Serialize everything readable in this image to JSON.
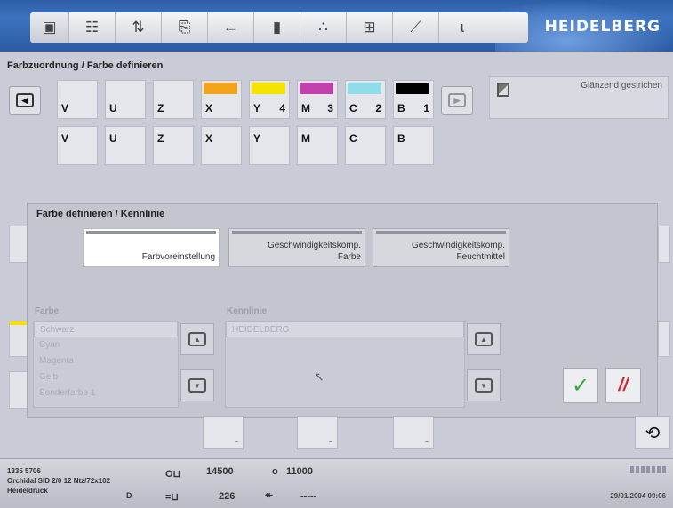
{
  "toolbar": {
    "brand": "HEIDELBERG",
    "tools": [
      {
        "name": "device-tool",
        "glyph": "▣"
      },
      {
        "name": "list-tool",
        "glyph": "☷"
      },
      {
        "name": "transfer-tool",
        "glyph": "⇅"
      },
      {
        "name": "paper-tool",
        "glyph": "⎘"
      },
      {
        "name": "arrow-tool",
        "glyph": "←"
      },
      {
        "name": "ink-tool",
        "glyph": "▮"
      },
      {
        "name": "spray-tool",
        "glyph": "∴"
      },
      {
        "name": "plate-tool",
        "glyph": "⊞"
      },
      {
        "name": "measure-tool",
        "glyph": "⟋"
      },
      {
        "name": "signal-tool",
        "glyph": "ɩ"
      }
    ]
  },
  "section_title": "Farbzuordnung / Farbe definieren",
  "nav": {
    "prev_glyph": "◀",
    "next_glyph": "▶"
  },
  "top_units": [
    {
      "label": "V",
      "num": "",
      "color": ""
    },
    {
      "label": "U",
      "num": "",
      "color": ""
    },
    {
      "label": "Z",
      "num": "",
      "color": ""
    },
    {
      "label": "X",
      "num": "",
      "color": "#f2a51c"
    },
    {
      "label": "Y",
      "num": "4",
      "color": "#f6e400"
    },
    {
      "label": "M",
      "num": "3",
      "color": "#c23fae"
    },
    {
      "label": "C",
      "num": "2",
      "color": "#8fdde9"
    },
    {
      "label": "B",
      "num": "1",
      "color": "#000000"
    }
  ],
  "bottom_units": [
    "V",
    "U",
    "Z",
    "X",
    "Y",
    "M",
    "C",
    "B"
  ],
  "paper_info": "Glänzend gestrichen",
  "dialog": {
    "title": "Farbe definieren / Kennlinie",
    "modes": [
      {
        "line1": "",
        "line2": "Farbvoreinstellung",
        "active": true
      },
      {
        "line1": "Geschwindigkeitskomp.",
        "line2": "Farbe",
        "active": false
      },
      {
        "line1": "Geschwindigkeitskomp.",
        "line2": "Feuchtmittel",
        "active": false
      }
    ],
    "farbe_label": "Farbe",
    "farbe_items": [
      "Schwarz",
      "Cyan",
      "Magenta",
      "Gelb",
      "Sonderfarbe 1"
    ],
    "kennlinie_label": "Kennlinie",
    "kennlinie_items": [
      "HEIDELBERG"
    ],
    "ok_glyph": "✓",
    "cancel_glyph": "//"
  },
  "bottom_buttons": [
    "-",
    "-",
    "-"
  ],
  "status": {
    "job_line1": "1335 5706",
    "job_line2": "Orchidal SID 2/0 12 Ntz/72x102",
    "job_line3": "Heideldruck",
    "job_mark": "D",
    "counter1_symbol": "O⊔",
    "counter1": "14500",
    "counter2_symbol": "o",
    "counter2": "11000",
    "counter3_symbol": "=⊔",
    "counter3": "226",
    "counter4_symbol": "↞",
    "counter4": "-----",
    "datetime": "29/01/2004 09:06"
  }
}
